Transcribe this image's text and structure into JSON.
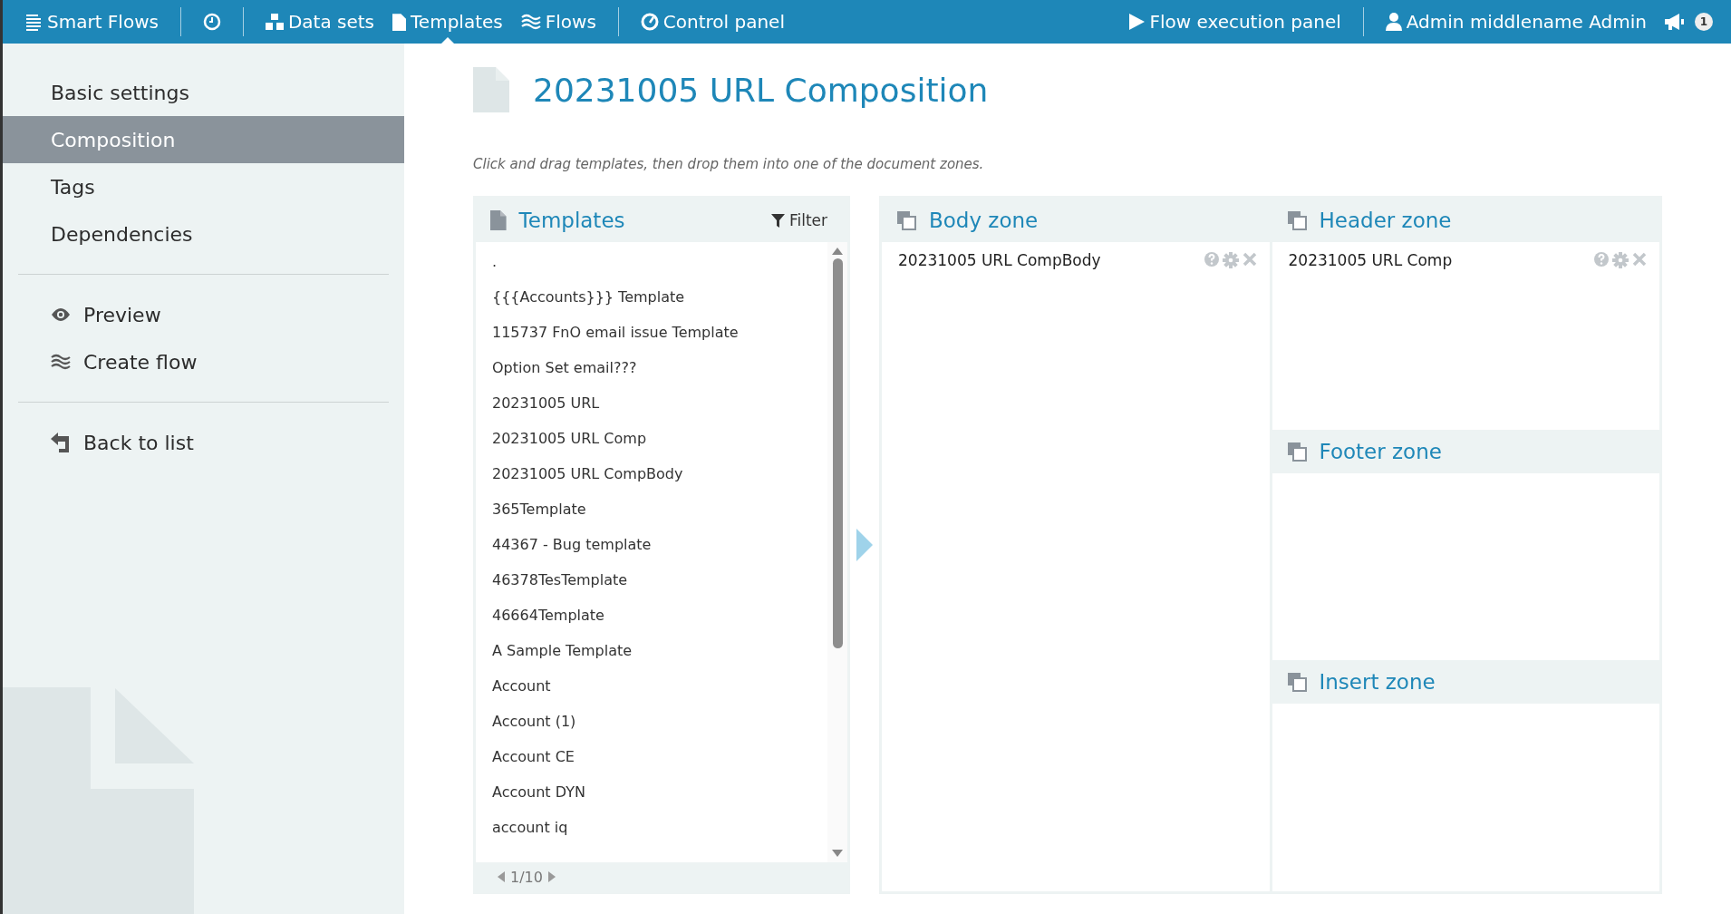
{
  "topbar": {
    "brand": "Smart Flows",
    "nav": [
      {
        "kind": "clock",
        "selected": false
      },
      {
        "kind": "datasets",
        "label": "Data sets",
        "selected": false
      },
      {
        "kind": "templates",
        "label": "Templates",
        "selected": true
      },
      {
        "kind": "flows",
        "label": "Flows",
        "selected": false
      },
      {
        "kind": "control",
        "label": "Control panel",
        "selected": false
      }
    ],
    "right": [
      {
        "kind": "play",
        "label": "Flow execution panel"
      },
      {
        "kind": "user",
        "label": "Admin middlename Admin"
      }
    ],
    "notifications": "1"
  },
  "sidebar": {
    "groups": [
      [
        {
          "kind": "plain",
          "label": "Basic settings",
          "selected": false
        },
        {
          "kind": "plain",
          "label": "Composition",
          "selected": true
        },
        {
          "kind": "plain",
          "label": "Tags",
          "selected": false
        },
        {
          "kind": "plain",
          "label": "Dependencies",
          "selected": false
        }
      ],
      [
        {
          "kind": "eye",
          "label": "Preview",
          "selected": false
        },
        {
          "kind": "flow",
          "label": "Create flow",
          "selected": false
        }
      ],
      [
        {
          "kind": "back",
          "label": "Back to list",
          "selected": false
        }
      ]
    ]
  },
  "title": "20231005 URL Composition",
  "hint": "Click and drag templates, then drop them into one of the document zones.",
  "templates": {
    "title": "Templates",
    "filter": "Filter",
    "page": "1/10",
    "items": [
      ".",
      "{{{Accounts}}} Template",
      "115737 FnO email issue Template",
      "Option Set email???",
      "20231005 URL",
      "20231005 URL Comp",
      "20231005 URL CompBody",
      "365Template",
      "44367 - Bug template",
      "46378TesTemplate",
      "46664Template",
      "A Sample Template",
      "Account",
      "Account (1)",
      "Account CE",
      "Account DYN",
      "account iq"
    ]
  },
  "zones": [
    {
      "title": "Body zone",
      "items": [
        "20231005 URL CompBody"
      ]
    },
    {
      "title": "Header zone",
      "items": [
        "20231005 URL Comp"
      ]
    },
    {
      "title": "Footer zone"
    },
    {
      "title": "Insert zone"
    }
  ]
}
